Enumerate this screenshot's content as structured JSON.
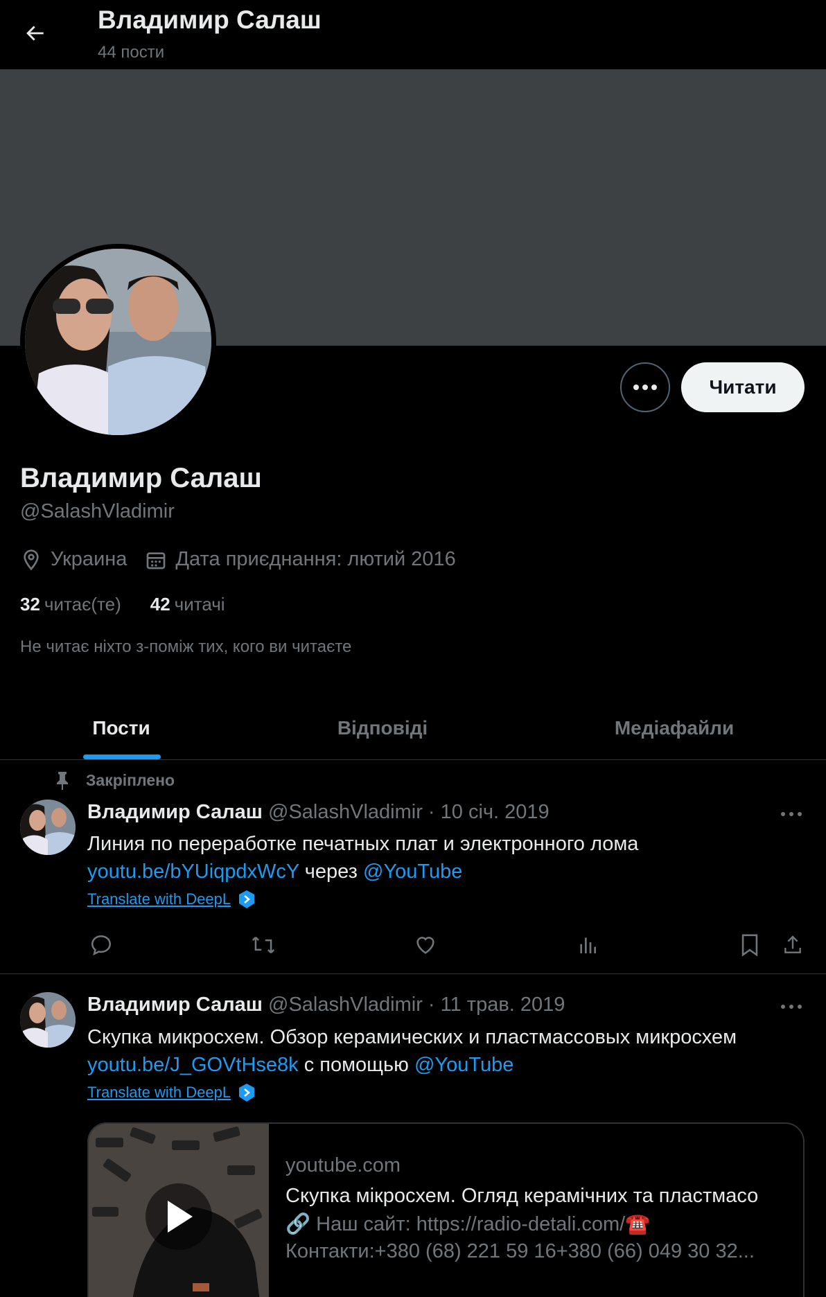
{
  "header": {
    "title": "Владимир Салаш",
    "subtitle": "44 пости"
  },
  "profile": {
    "name": "Владимир Салаш",
    "handle": "@SalashVladimir",
    "location": "Украина",
    "joined": "Дата приєднання: лютий 2016",
    "following_count": "32",
    "following_label": "читає(те)",
    "followers_count": "42",
    "followers_label": "читачі",
    "not_followed_note": "Не читає ніхто з-поміж тих, кого ви читаєте",
    "follow_label": "Читати"
  },
  "tabs": [
    {
      "label": "Пости",
      "active": true
    },
    {
      "label": "Відповіді",
      "active": false
    },
    {
      "label": "Медіафайли",
      "active": false
    }
  ],
  "posts": [
    {
      "pinned_label": "Закріплено",
      "name": "Владимир Салаш",
      "handle": "@SalashVladimir",
      "date": "· 10 січ. 2019",
      "text": "Линия по переработке печатных плат и электронного лома",
      "link": "youtu.be/bYUiqpdxWcY",
      "connector": " через ",
      "mention": "@YouTube",
      "translate": "Translate with DeepL"
    },
    {
      "name": "Владимир Салаш",
      "handle": "@SalashVladimir",
      "date": "· 11 трав. 2019",
      "text": "Скупка микросхем. Обзор керамических и пластмассовых микросхем",
      "link": "youtu.be/J_GOVtHse8k",
      "connector": " с помощью ",
      "mention": "@YouTube",
      "translate": "Translate with DeepL",
      "card": {
        "domain": "youtube.com",
        "title": "Скупка мікросхем. Огляд керамічних та пластмасо",
        "desc1": "🔗 Наш сайт: https://radio-detali.com/☎️",
        "desc2": "Контакти:+380 (68) 221 59 16+380 (66) 049 30 32..."
      }
    }
  ],
  "colors": {
    "accent": "#1d9bf0",
    "banner": "#3e4144",
    "muted": "#71767b"
  }
}
